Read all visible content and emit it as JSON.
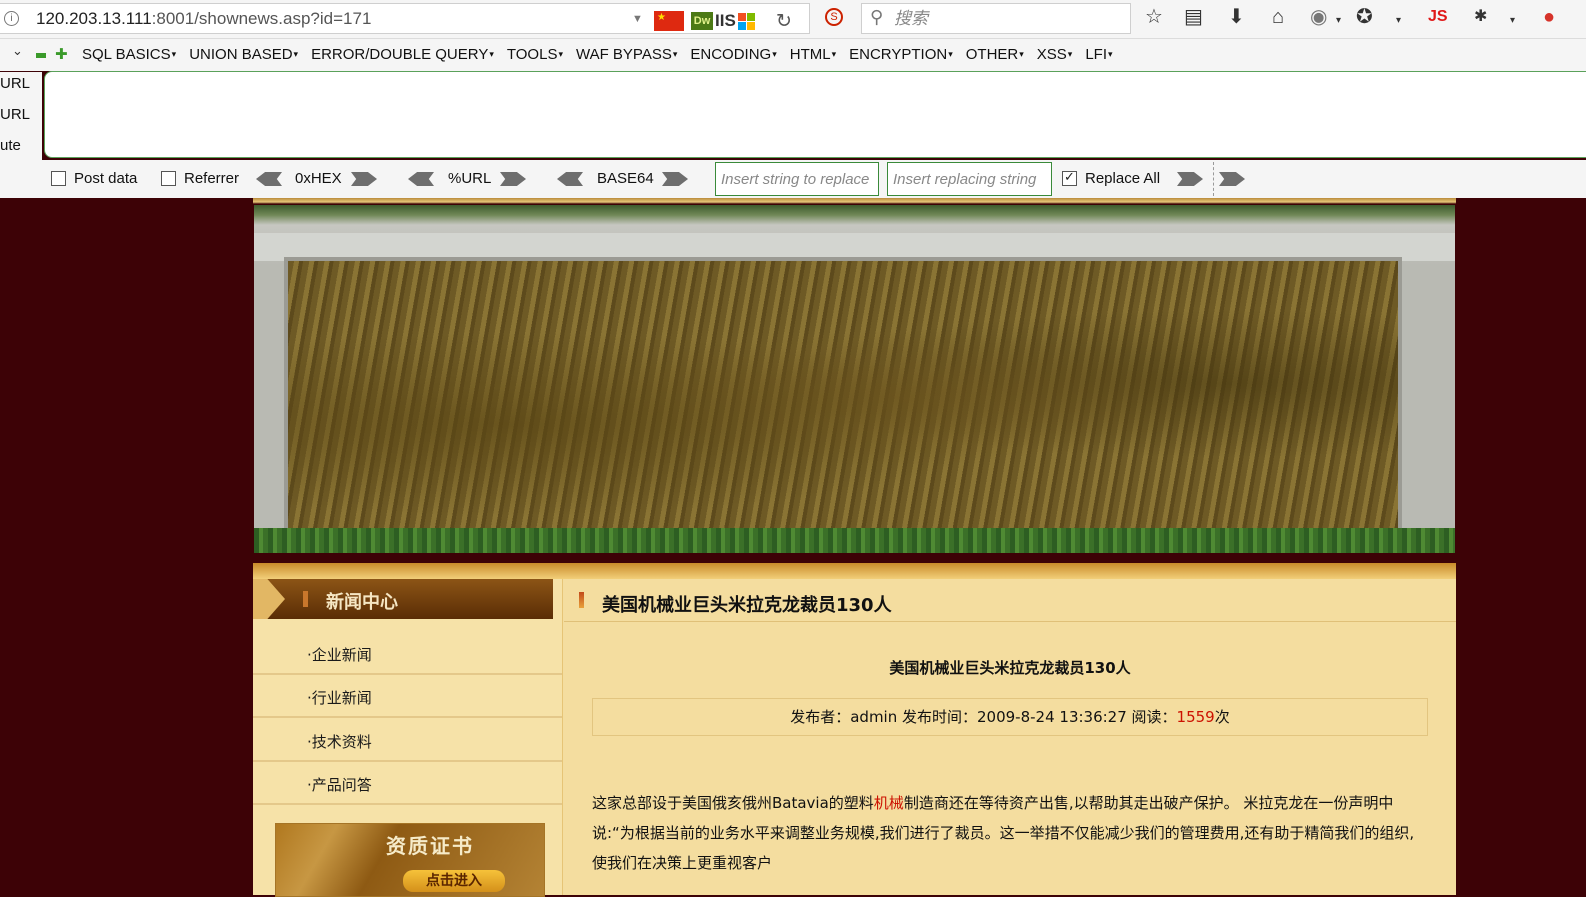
{
  "browser": {
    "url_host": "120.203.13.111",
    "url_path": ":8001/shownews.asp?id=171",
    "search_placeholder": "搜索",
    "dw_label": "Dw",
    "iis_label": "IIS",
    "js_label": "JS"
  },
  "hackbar": {
    "menu": [
      "SQL BASICS",
      "UNION BASED",
      "ERROR/DOUBLE QUERY",
      "TOOLS",
      "WAF BYPASS",
      "ENCODING",
      "HTML",
      "ENCRYPTION",
      "OTHER",
      "XSS",
      "LFI"
    ],
    "side_labels": [
      "URL",
      "URL",
      "ute"
    ],
    "post_data_label": "Post data",
    "referrer_label": "Referrer",
    "hex_label": "0xHEX",
    "url_label": "%URL",
    "base64_label": "BASE64",
    "replace_from_placeholder": "Insert string to replace",
    "replace_to_placeholder": "Insert replacing string",
    "replace_all_label": "Replace All",
    "replace_all_checked": true
  },
  "site": {
    "sidebar_title": "新闻中心",
    "nav": [
      "·企业新闻",
      "·行业新闻",
      "·技术资料",
      "·产品问答"
    ],
    "cert_title": "资质证书",
    "cert_button": "点击进入",
    "header_title": "美国机械业巨头米拉克龙裁员130人",
    "article_title": "美国机械业巨头米拉克龙裁员130人",
    "meta_prefix": "发布者：admin 发布时间：2009-8-24 13:36:27 阅读：",
    "views": "1559",
    "meta_suffix": "次",
    "body_part1": "这家总部设于美国俄亥俄州Batavia的塑料",
    "body_keyword": "机械",
    "body_part2": "制造商还在等待资产出售,以帮助其走出破产保护。 米拉克龙在一份声明中说:“为根据当前的业务水平来调整业务规模,我们进行了裁员。这一举措不仅能减少我们的管理费用,还有助于精简我们的组织,使我们在决策上更重视客户"
  },
  "colors": {
    "page_bg": "#3d0206",
    "content_bg": "#f4dd9f",
    "keyword": "#cc1100",
    "hackbar_green": "#3a8a3a"
  }
}
